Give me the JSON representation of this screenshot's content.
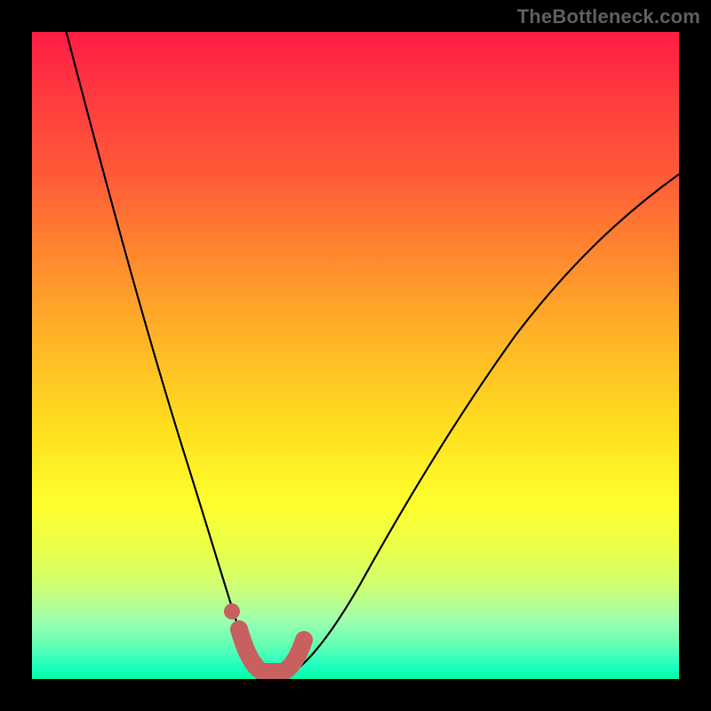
{
  "attribution": "TheBottleneck.com",
  "colors": {
    "background": "#000000",
    "gradient_top": "#ff1c45",
    "gradient_bottom": "#00ffa9",
    "curve": "#000000",
    "marker": "#c7605e"
  },
  "chart_data": {
    "type": "line",
    "title": "",
    "xlabel": "",
    "ylabel": "",
    "xlim": [
      0,
      100
    ],
    "ylim": [
      0,
      100
    ],
    "series": [
      {
        "name": "bottleneck-curve",
        "x": [
          5,
          7,
          9,
          11,
          13,
          15,
          17,
          19,
          21,
          23,
          25,
          27,
          29,
          31,
          32.5,
          34,
          36,
          38,
          41,
          44,
          47,
          50,
          55,
          60,
          65,
          70,
          75,
          80,
          85,
          90,
          95,
          100
        ],
        "y": [
          100,
          91,
          83,
          75,
          68,
          61,
          54,
          47,
          41,
          35,
          29,
          23,
          17,
          11,
          7,
          3,
          0,
          0,
          3,
          8,
          14,
          20,
          29,
          37,
          44,
          50,
          56,
          61,
          66,
          70,
          74,
          78
        ]
      }
    ],
    "marker_segment": {
      "name": "optimal-range",
      "x": [
        31,
        32.5,
        34,
        36,
        38,
        40
      ],
      "y": [
        9,
        5,
        2,
        0,
        0,
        2
      ]
    },
    "marker_dot": {
      "x": 30,
      "y": 11
    }
  }
}
